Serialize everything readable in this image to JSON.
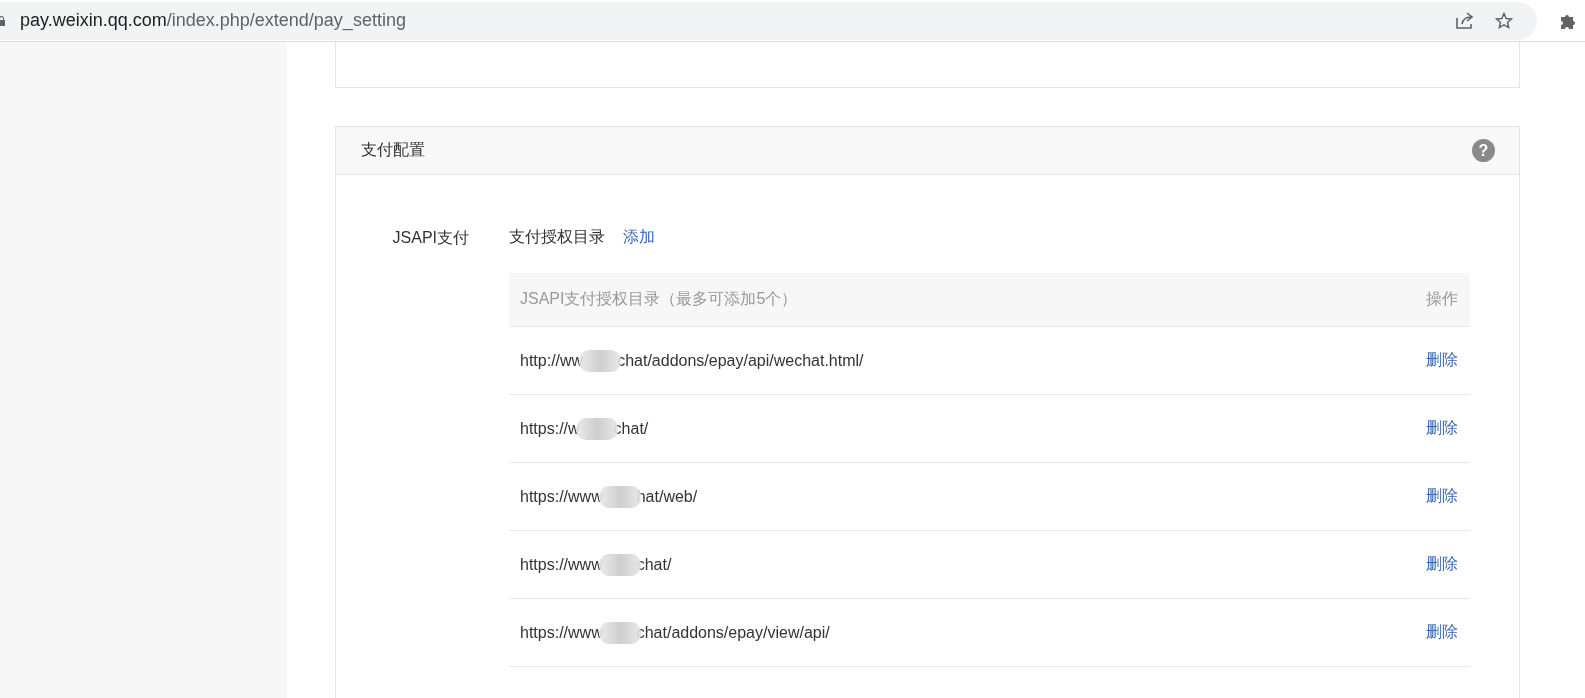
{
  "browser": {
    "url_host": "pay.weixin.qq.com",
    "url_path": "/index.php/extend/pay_setting"
  },
  "section": {
    "title": "支付配置",
    "help_icon": "?"
  },
  "jsapi": {
    "label": "JSAPI支付",
    "directory_label": "支付授权目录",
    "add_link": "添加"
  },
  "table": {
    "columns": [
      "JSAPI支付授权目录（最多可添加5个）",
      "操作"
    ],
    "rows": [
      {
        "url_start": "http://ww",
        "url_end": "chat/addons/epay/api/wechat.html/",
        "action": "删除"
      },
      {
        "url_start": "https://w",
        "url_end": "chat/",
        "action": "删除"
      },
      {
        "url_start": "https://www",
        "url_end": "hat/web/",
        "action": "删除"
      },
      {
        "url_start": "https://www",
        "url_end": "chat/",
        "action": "删除"
      },
      {
        "url_start": "https://www",
        "url_end": "chat/addons/epay/view/api/",
        "action": "删除"
      }
    ]
  }
}
